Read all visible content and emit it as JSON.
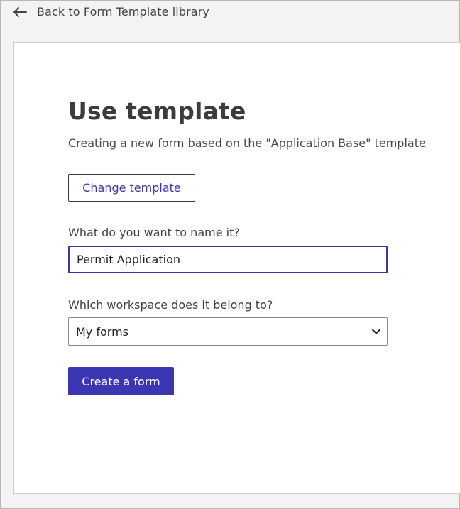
{
  "nav": {
    "back_label": "Back to Form Template library",
    "back_icon": "arrow-left-icon"
  },
  "page": {
    "title": "Use template",
    "subtitle": "Creating a new form based on the \"Application Base\" template"
  },
  "actions": {
    "change_template_label": "Change template",
    "create_form_label": "Create a form"
  },
  "form": {
    "name_label": "What do you want to name it?",
    "name_value": "Permit Application",
    "workspace_label": "Which workspace does it belong to?",
    "workspace_selected": "My forms",
    "workspace_icon": "chevron-down-icon"
  },
  "colors": {
    "accent": "#3b37b3",
    "page_background": "#f3f3f3",
    "card_background": "#ffffff"
  }
}
